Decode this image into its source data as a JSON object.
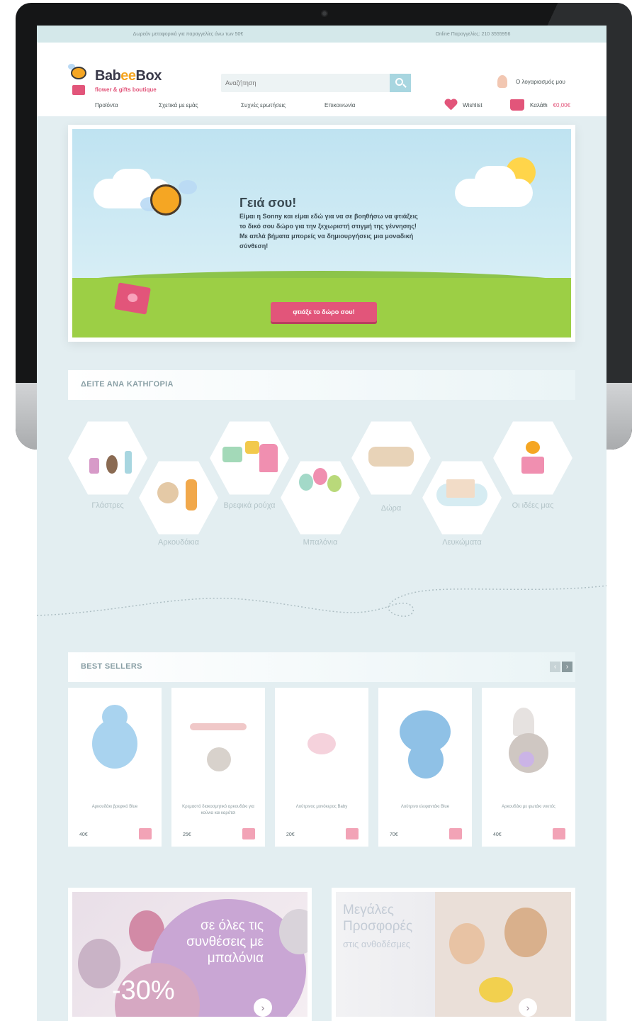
{
  "topbar": {
    "left": "Δωρεάν μεταφορικά για παραγγελίες άνω των 50€",
    "right": "Online Παραγγελίες: 210 3555956"
  },
  "brand": {
    "name_prefix": "Bab",
    "name_ee": "ee",
    "name_suffix": "Box",
    "tagline": "flower & gifts boutique"
  },
  "search": {
    "placeholder": "Αναζήτηση"
  },
  "account": {
    "label": "Ο λογαριασμός μου"
  },
  "nav": {
    "items": [
      "Προϊόντα",
      "Σχετικά με εμάς",
      "Συχνές ερωτήσεις",
      "Επικοινωνία"
    ],
    "wishlist_label": "Wishlist",
    "cart_label": "Καλάθι",
    "cart_total": "€0,00€"
  },
  "hero": {
    "title": "Γειά σου!",
    "text": "Είμαι η Sonny και είμαι εδώ για να σε βοηθήσω να φτιάξεις το δικό σου δώρο για την ξεχωριστή στιγμή της γέννησης! Με απλά βήματα μπορείς να δημιουργήσεις μια μοναδική σύνθεση!",
    "cta": "φτιάξε το δώρο σου!"
  },
  "categories": {
    "title": "ΔΕΙΤΕ ΑΝΑ ΚΑΤΗΓΟΡΙΑ",
    "items": [
      "Γλάστρες",
      "Αρκουδάκια",
      "Βρεφικά ρούχα",
      "Μπαλόνια",
      "Δώρα",
      "Λευκώματα",
      "Οι ιδέες μας"
    ]
  },
  "bestsellers": {
    "title": "BEST SELLERS",
    "products": [
      {
        "name": "Αρκουδάκι βρεφικό Blue",
        "price": "40€"
      },
      {
        "name": "Κρεμαστό διακοσμητικό αρκουδάκι για κούνια και καρότσι",
        "price": "25€"
      },
      {
        "name": "Λούτρινος μονόκερος Baby",
        "price": "20€"
      },
      {
        "name": "Λούτρινο ελεφαντάκι Blue",
        "price": "70€"
      },
      {
        "name": "Αρκουδάκι με φωτάκι νυκτός",
        "price": "40€"
      }
    ]
  },
  "promos": {
    "left_text": "σε όλες τις συνθέσεις με μπαλόνια",
    "left_discount": "-30%",
    "right_title": "Μεγάλες Προσφορές",
    "right_subtitle": "στις ανθοδέσμες"
  },
  "colors": {
    "accent": "#e2557a",
    "brand_orange": "#f5a623",
    "bg": "#e3eef1",
    "topbar": "#d4e8ea"
  }
}
